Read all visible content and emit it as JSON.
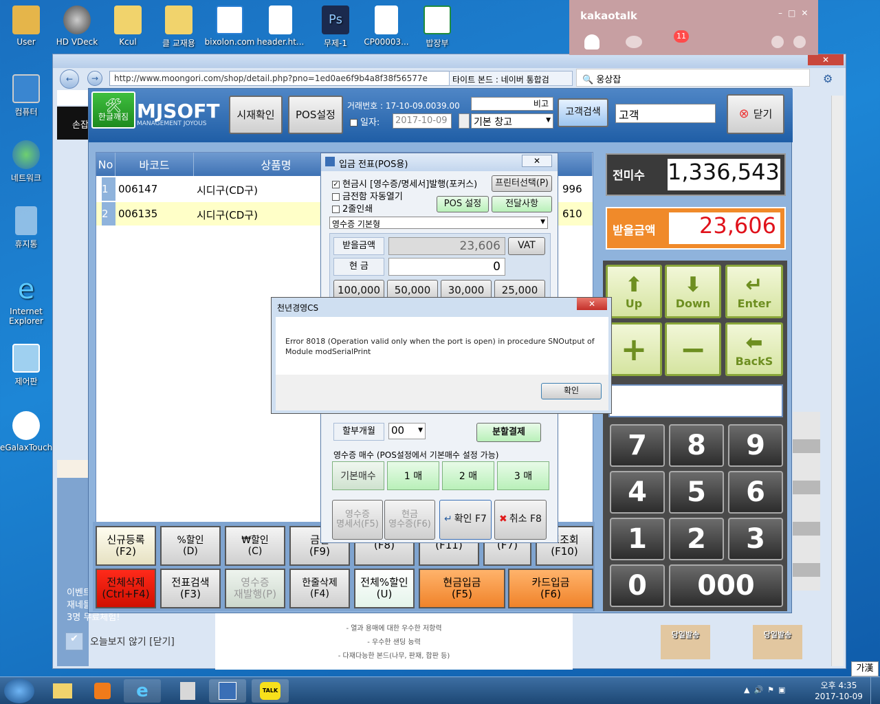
{
  "desktop": {
    "top_icons": [
      "User",
      "HD VDeck",
      "Kcul",
      "클 교재용",
      "bixolon.com",
      "header.ht...",
      "무제-1",
      "CP00003...",
      "밥장부"
    ],
    "left_icons": [
      "컴퓨터",
      "네트워크",
      "휴지통",
      "Internet Explorer",
      "제어판",
      "eGalaxTouch"
    ]
  },
  "kakao": {
    "title": "kakaotalk",
    "badge": "11",
    "search_value": "웅상잡"
  },
  "browser": {
    "url": "http://www.moongori.com/shop/detail.php?pno=1ed0ae6f9b4a8f38f56577e",
    "tab_title": "타이트 본드 : 네이버 통합검",
    "left_panel_text": [
      "이벤트",
      "재네들",
      "3명 무료체험!"
    ],
    "left_panel_top": "손잡",
    "dismiss_label": "오늘보지 않기 [닫기]",
    "ad_lines": [
      "- 열과 용매에 대한 우수한 저항력",
      "- 우수한 샌딩 능력",
      "- 다재다능한 본드(나무, 판재, 합판 등)"
    ],
    "ad_badges": [
      "당일발송",
      "당일발송"
    ],
    "ime_label": "가漢"
  },
  "pos": {
    "hangul_btn": "한글깨짐",
    "logo": "MJSOFT",
    "logo_sub": "MANAGEMENT JOYOUS",
    "btn_market": "시재확인",
    "btn_pos_settings": "POS설정",
    "trade_no_label": "거래번호 : 17-10-09.0039.00",
    "compare_label": "비고",
    "date_label": "일자:",
    "date_value": "2017-10-09",
    "warehouse": "기본 창고",
    "customer_search": "고객검색",
    "customer_value": "고객",
    "close_label": "닫기",
    "grid_headers": [
      "No",
      "바코드",
      "상품명"
    ],
    "rows": [
      {
        "no": "1",
        "barcode": "006147",
        "name": "시디구(CD구)",
        "amount": "996"
      },
      {
        "no": "2",
        "barcode": "006135",
        "name": "시디구(CD구)",
        "amount": "610"
      }
    ],
    "prev_unpaid_label": "전미수",
    "prev_unpaid_value": "1,336,543",
    "receive_label": "받을금액",
    "receive_value": "23,606",
    "keys": {
      "up": "Up",
      "down": "Down",
      "enter": "Enter",
      "back": "BackS",
      "n7": "7",
      "n8": "8",
      "n9": "9",
      "n4": "4",
      "n5": "5",
      "n6": "6",
      "n1": "1",
      "n2": "2",
      "n3": "3",
      "n0": "0",
      "n000": "000"
    },
    "fkeys_row1": [
      {
        "l1": "신규등록",
        "l2": "(F2)"
      },
      {
        "l1": "%할인",
        "l2": "(D)"
      },
      {
        "l1": "₩할인",
        "l2": "(C)"
      },
      {
        "l1": "금전",
        "l2": "(F9)"
      },
      {
        "l1": "",
        "l2": "(F8)"
      },
      {
        "l1": "",
        "l2": "(F11)"
      },
      {
        "l1": "",
        "l2": "(F7)"
      },
      {
        "l1": "표조회",
        "l2": "(F10)"
      }
    ],
    "fkeys_row2": [
      {
        "l1": "전체삭제",
        "l2": "(Ctrl+F4)"
      },
      {
        "l1": "전표검색",
        "l2": "(F3)"
      },
      {
        "l1": "영수증",
        "l2": "재발행(P)"
      },
      {
        "l1": "한줄삭제",
        "l2": "(F4)"
      },
      {
        "l1": "전체%할인",
        "l2": "(U)"
      },
      {
        "l1": "현금입금",
        "l2": "(F5)"
      },
      {
        "l1": "카드입금",
        "l2": "(F6)"
      }
    ]
  },
  "receipt_dialog": {
    "title": "입금 전표(POS용)",
    "chk_cash": "현금시 [영수증/명세서]발행(포커스)",
    "chk_drawer": "금전함 자동열기",
    "chk_double": "2줄인쇄",
    "printer_btn": "프린터선택(P)",
    "pos_settings_btn": "POS 설정",
    "notice_btn": "전달사항",
    "receipt_type": "영수증 기본형",
    "receive_label": "받을금액",
    "receive_value": "23,606",
    "vat_btn": "VAT",
    "cash_label": "현  금",
    "cash_value": "0",
    "quick_amounts": [
      "100,000",
      "50,000",
      "30,000",
      "25,000"
    ],
    "installment_label": "할부개월",
    "installment_value": "00",
    "split_btn": "분할결제",
    "copies_label": "영수증 매수 (POS설정에서 기본매수 설정 가능)",
    "copies": [
      "기본매수",
      "1 매",
      "2 매",
      "3 매"
    ],
    "btn_stmt_l1": "영수증",
    "btn_stmt_l2": "명세서(F5)",
    "btn_cashr_l1": "현금",
    "btn_cashr_l2": "영수증(F6)",
    "btn_ok": "확인 F7",
    "btn_cancel": "취소 F8"
  },
  "error_dialog": {
    "title": "천년경영CS",
    "message": "Error 8018 (Operation valid only when the port is open) in procedure SNOutput of Module modSerialPrint",
    "ok": "확인"
  },
  "taskbar": {
    "clock_time": "오후 4:35",
    "clock_date": "2017-10-09"
  },
  "colors": {
    "accent_orange": "#f08a2a",
    "red_value": "#e0121b",
    "green_keypad": "#8aa63a"
  }
}
